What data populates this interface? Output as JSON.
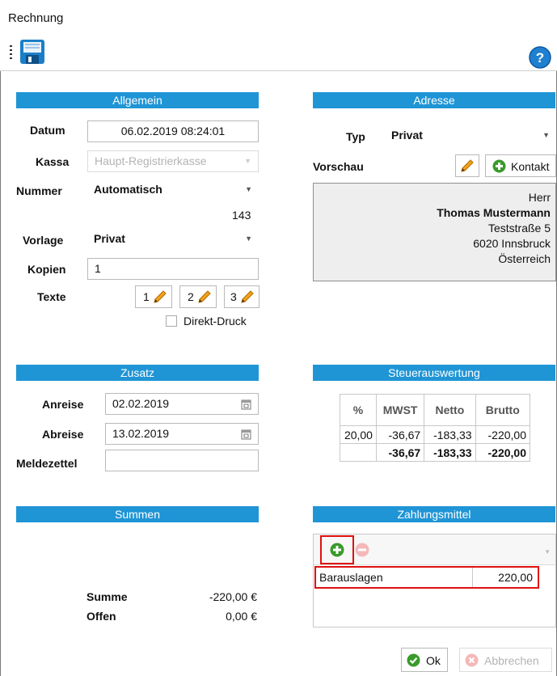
{
  "window": {
    "title": "Rechnung"
  },
  "toolbar": {
    "save_icon": "floppy-disk-icon",
    "help_icon": "question-icon"
  },
  "allgemein": {
    "header": "Allgemein",
    "datum_label": "Datum",
    "datum_value": "06.02.2019 08:24:01",
    "kassa_label": "Kassa",
    "kassa_value": "Haupt-Registrierkasse",
    "nummer_label": "Nummer",
    "nummer_value": "Automatisch",
    "nummer_count": "143",
    "vorlage_label": "Vorlage",
    "vorlage_value": "Privat",
    "kopien_label": "Kopien",
    "kopien_value": "1",
    "texte_label": "Texte",
    "texte_buttons": [
      "1",
      "2",
      "3"
    ],
    "direkt_label": "Direkt-Druck"
  },
  "adresse": {
    "header": "Adresse",
    "typ_label": "Typ",
    "typ_value": "Privat",
    "vorschau_label": "Vorschau",
    "kontakt_label": "Kontakt",
    "preview": [
      "Herr",
      "Thomas Mustermann",
      "Teststraße 5",
      "6020 Innsbruck",
      "Österreich"
    ]
  },
  "zusatz": {
    "header": "Zusatz",
    "anreise_label": "Anreise",
    "anreise_value": "02.02.2019",
    "abreise_label": "Abreise",
    "abreise_value": "13.02.2019",
    "meldezettel_label": "Meldezettel",
    "meldezettel_value": ""
  },
  "steuer": {
    "header": "Steuerauswertung",
    "columns": [
      "%",
      "MWST",
      "Netto",
      "Brutto"
    ],
    "row": [
      "20,00",
      "-36,67",
      "-183,33",
      "-220,00"
    ],
    "total": [
      "",
      "-36,67",
      "-183,33",
      "-220,00"
    ]
  },
  "summen": {
    "header": "Summen",
    "summe_label": "Summe",
    "summe_value": "-220,00 €",
    "offen_label": "Offen",
    "offen_value": "0,00 €"
  },
  "zahlung": {
    "header": "Zahlungsmittel",
    "item_name": "Barauslagen",
    "item_amount": "220,00"
  },
  "footer": {
    "ok_label": "Ok",
    "cancel_label": "Abbrechen"
  },
  "colors": {
    "header_blue": "#1f95d6",
    "add_green": "#3a9a2b",
    "highlight_red": "#e01010"
  }
}
